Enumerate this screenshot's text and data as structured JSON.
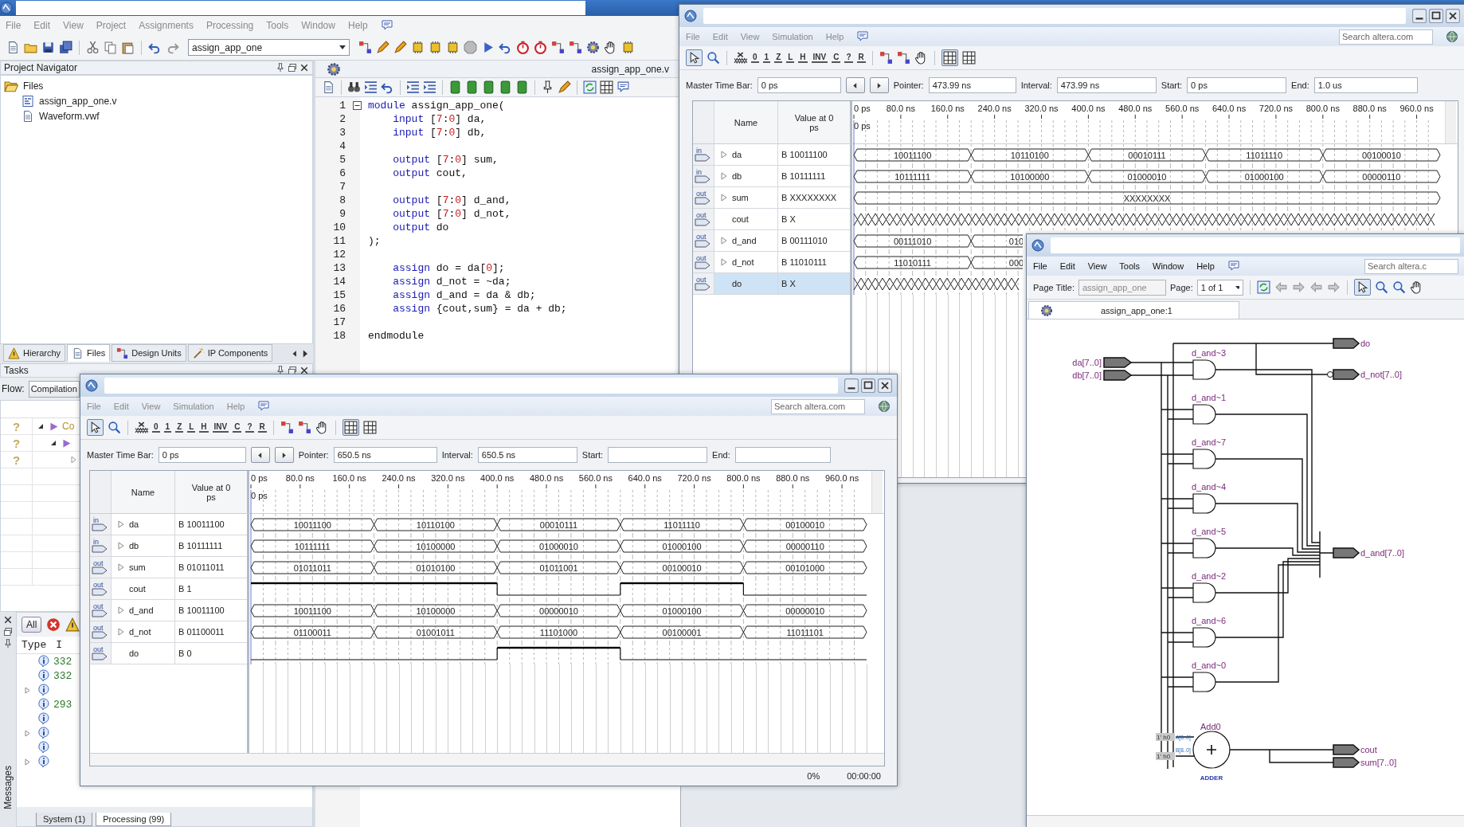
{
  "ide": {
    "menu": [
      "File",
      "Edit",
      "View",
      "Project",
      "Assignments",
      "Processing",
      "Tools",
      "Window",
      "Help"
    ],
    "project_select": "assign_app_one",
    "project_navigator": {
      "title": "Project Navigator",
      "tree": [
        {
          "label": "Files",
          "expanded": true,
          "children": [
            {
              "label": "assign_app_one.v",
              "kind": "source"
            },
            {
              "label": "Waveform.vwf",
              "kind": "document"
            }
          ]
        }
      ],
      "tabs": [
        {
          "label": "Hierarchy",
          "selected": false
        },
        {
          "label": "Files",
          "selected": true
        },
        {
          "label": "Design Units",
          "selected": false
        },
        {
          "label": "IP Components",
          "selected": false
        }
      ]
    },
    "editor": {
      "title": "assign_app_one.v",
      "lines": [
        {
          "number": "1",
          "fold_start": true,
          "tokens": [
            {
              "text": "module",
              "kind": "keyword"
            },
            {
              "text": " assign_app_one(",
              "kind": "plain"
            }
          ]
        },
        {
          "number": "2",
          "fold_start": false,
          "tokens": [
            {
              "text": "    input",
              "kind": "keyword"
            },
            {
              "text": " [",
              "kind": "plain"
            },
            {
              "text": "7",
              "kind": "number"
            },
            {
              "text": ":",
              "kind": "plain"
            },
            {
              "text": "0",
              "kind": "number"
            },
            {
              "text": "] da,",
              "kind": "plain"
            }
          ]
        },
        {
          "number": "3",
          "fold_start": false,
          "tokens": [
            {
              "text": "    input",
              "kind": "keyword"
            },
            {
              "text": " [",
              "kind": "plain"
            },
            {
              "text": "7",
              "kind": "number"
            },
            {
              "text": ":",
              "kind": "plain"
            },
            {
              "text": "0",
              "kind": "number"
            },
            {
              "text": "] db,",
              "kind": "plain"
            }
          ]
        },
        {
          "number": "4",
          "fold_start": false
        },
        {
          "number": "5",
          "fold_start": false,
          "tokens": [
            {
              "text": "    output",
              "kind": "keyword"
            },
            {
              "text": " [",
              "kind": "plain"
            },
            {
              "text": "7",
              "kind": "number"
            },
            {
              "text": ":",
              "kind": "plain"
            },
            {
              "text": "0",
              "kind": "number"
            },
            {
              "text": "] sum,",
              "kind": "plain"
            }
          ]
        },
        {
          "number": "6",
          "fold_start": false,
          "tokens": [
            {
              "text": "    output",
              "kind": "keyword"
            },
            {
              "text": " cout,",
              "kind": "plain"
            }
          ]
        },
        {
          "number": "7",
          "fold_start": false
        },
        {
          "number": "8",
          "fold_start": false,
          "tokens": [
            {
              "text": "    output",
              "kind": "keyword"
            },
            {
              "text": " [",
              "kind": "plain"
            },
            {
              "text": "7",
              "kind": "number"
            },
            {
              "text": ":",
              "kind": "plain"
            },
            {
              "text": "0",
              "kind": "number"
            },
            {
              "text": "] d_and,",
              "kind": "plain"
            }
          ]
        },
        {
          "number": "9",
          "fold_start": false,
          "tokens": [
            {
              "text": "    output",
              "kind": "keyword"
            },
            {
              "text": " [",
              "kind": "plain"
            },
            {
              "text": "7",
              "kind": "number"
            },
            {
              "text": ":",
              "kind": "plain"
            },
            {
              "text": "0",
              "kind": "number"
            },
            {
              "text": "] d_not,",
              "kind": "plain"
            }
          ]
        },
        {
          "number": "10",
          "fold_start": false,
          "tokens": [
            {
              "text": "    output",
              "kind": "keyword"
            },
            {
              "text": " do",
              "kind": "plain"
            }
          ]
        },
        {
          "number": "11",
          "fold_start": false,
          "tokens": [
            {
              "text": ");",
              "kind": "plain"
            }
          ]
        },
        {
          "number": "12",
          "fold_start": false
        },
        {
          "number": "13",
          "fold_start": false,
          "tokens": [
            {
              "text": "    assign",
              "kind": "keyword"
            },
            {
              "text": " do = da[",
              "kind": "plain"
            },
            {
              "text": "0",
              "kind": "number"
            },
            {
              "text": "];",
              "kind": "plain"
            }
          ]
        },
        {
          "number": "14",
          "fold_start": false,
          "tokens": [
            {
              "text": "    assign",
              "kind": "keyword"
            },
            {
              "text": " d_not = ~da;",
              "kind": "plain"
            }
          ]
        },
        {
          "number": "15",
          "fold_start": false,
          "tokens": [
            {
              "text": "    assign",
              "kind": "keyword"
            },
            {
              "text": " d_and = da & db;",
              "kind": "plain"
            }
          ]
        },
        {
          "number": "16",
          "fold_start": false,
          "tokens": [
            {
              "text": "    assign",
              "kind": "keyword"
            },
            {
              "text": " {cout,sum} = da + db;",
              "kind": "plain"
            }
          ]
        },
        {
          "number": "17",
          "fold_start": false
        },
        {
          "number": "18",
          "fold_start": false,
          "tokens": [
            {
              "text": "endmodule",
              "kind": "plain"
            }
          ]
        }
      ]
    },
    "tasks": {
      "title": "Tasks",
      "flow_label": "Flow:",
      "flow": "Compilation",
      "rows": [
        {
          "kind": "group",
          "status": "?",
          "expanded": true,
          "label": "Co"
        },
        {
          "kind": "group",
          "status": "?",
          "expanded": true
        },
        {
          "kind": "note",
          "status": "?",
          "expanded": false
        }
      ]
    },
    "messages": {
      "title": "Messages",
      "filter": "All",
      "columns": [
        "Type",
        "I"
      ],
      "rows": [
        {
          "expandable": false,
          "id": "332"
        },
        {
          "expandable": false,
          "id": "332"
        },
        {
          "expandable": true
        },
        {
          "expandable": false,
          "id": "293"
        },
        {
          "expandable": false
        },
        {
          "expandable": true
        },
        {
          "expandable": false
        },
        {
          "expandable": true
        }
      ],
      "tabs": [
        {
          "label": "System (1)",
          "selected": false
        },
        {
          "label": "Processing (99)",
          "selected": true
        }
      ]
    }
  },
  "simulation_top": {
    "menu": [
      "File",
      "Edit",
      "View",
      "Simulation",
      "Help"
    ],
    "search": {
      "placeholder": "Search altera.com"
    },
    "tool_glyphs": [
      "0",
      "1",
      "Z",
      "L",
      "H",
      "INV",
      "C",
      "?",
      "R"
    ],
    "time_bar": {
      "master_label": "Master Time Bar:",
      "master": "0 ps",
      "pointer_label": "Pointer:",
      "pointer": "473.99 ns",
      "interval_label": "Interval:",
      "interval": "473.99 ns",
      "start_label": "Start:",
      "start": "0 ps",
      "end_label": "End:",
      "end": "1.0 us"
    },
    "columns": [
      "Name",
      "Value at 0 ps"
    ],
    "ticks": [
      "0 ps",
      "80.0 ns",
      "160.0 ns",
      "240.0 ns",
      "320.0 ns",
      "400.0 ns",
      "480.0 ns",
      "560.0 ns",
      "640.0 ns",
      "720.0 ns",
      "800.0 ns",
      "880.0 ns",
      "960.0 ns"
    ],
    "cursor_label": "0 ps",
    "signals": [
      {
        "direction": "in",
        "name": "da",
        "expandable": true,
        "value": "B 10011100",
        "kind": "bus",
        "selected": false,
        "segments": [
          "10011100",
          "10110100",
          "00010111",
          "11011110",
          "00100010"
        ]
      },
      {
        "direction": "in",
        "name": "db",
        "expandable": true,
        "value": "B 10111111",
        "kind": "bus",
        "selected": false,
        "segments": [
          "10111111",
          "10100000",
          "01000010",
          "01000100",
          "00000110"
        ]
      },
      {
        "direction": "out",
        "name": "sum",
        "expandable": true,
        "value": "B XXXXXXXX",
        "kind": "bus",
        "selected": false,
        "segments": [
          "XXXXXXXX"
        ]
      },
      {
        "direction": "out",
        "name": "cout",
        "expandable": false,
        "value": "B X",
        "kind": "unknown",
        "selected": false
      },
      {
        "direction": "out",
        "name": "d_and",
        "expandable": true,
        "value": "B 00111010",
        "kind": "bus",
        "selected": false,
        "segments": [
          "00111010",
          "010"
        ]
      },
      {
        "direction": "out",
        "name": "d_not",
        "expandable": true,
        "value": "B 11010111",
        "kind": "bus",
        "selected": false,
        "segments": [
          "11010111",
          "000"
        ]
      },
      {
        "direction": "out",
        "name": "do",
        "expandable": false,
        "value": "B X",
        "kind": "unknown",
        "selected": true
      }
    ]
  },
  "schematic": {
    "menu": [
      "File",
      "Edit",
      "View",
      "Tools",
      "Window",
      "Help"
    ],
    "search": {
      "placeholder": "Search altera.c"
    },
    "page_title_label": "Page Title:",
    "page_title": "assign_app_one",
    "page_label": "Page:",
    "page": "1 of 1",
    "tab": "assign_app_one:1",
    "inputs": [
      "da[7..0]",
      "db[7..0]"
    ],
    "gates": [
      "d_and~3",
      "d_and~1",
      "d_and~7",
      "d_and~4",
      "d_and~5",
      "d_and~2",
      "d_and~6",
      "d_and~0"
    ],
    "outputs": [
      {
        "label": "do",
        "inverted": false
      },
      {
        "label": "d_not[7..0]",
        "inverted": true
      },
      {
        "label": "d_and[7..0]",
        "inverted": false
      },
      {
        "label": "cout",
        "inverted": false
      },
      {
        "label": "sum[7..0]",
        "inverted": false
      }
    ],
    "adder": {
      "name": "Add0",
      "type": "ADDER",
      "ports": [
        "A[8..0]",
        "B[8..0]"
      ],
      "constants": [
        "1' h0",
        "1' h0"
      ]
    }
  },
  "simulation_bottom": {
    "menu": [
      "File",
      "Edit",
      "View",
      "Simulation",
      "Help"
    ],
    "search": {
      "placeholder": "Search altera.com"
    },
    "tool_glyphs": [
      "0",
      "1",
      "Z",
      "L",
      "H",
      "INV",
      "C",
      "?",
      "R"
    ],
    "time_bar": {
      "master_label": "Master Time Bar:",
      "master": "0 ps",
      "pointer_label": "Pointer:",
      "pointer": "650.5 ns",
      "interval_label": "Interval:",
      "interval": "650.5 ns",
      "start_label": "Start:",
      "end_label": "End:"
    },
    "columns": [
      "Name",
      "Value at 0 ps"
    ],
    "ticks": [
      "0 ps",
      "80.0 ns",
      "160.0 ns",
      "240.0 ns",
      "320.0 ns",
      "400.0 ns",
      "480.0 ns",
      "560.0 ns",
      "640.0 ns",
      "720.0 ns",
      "800.0 ns",
      "880.0 ns",
      "960.0 ns"
    ],
    "cursor_label": "0 ps",
    "signals": [
      {
        "direction": "in",
        "name": "da",
        "expandable": true,
        "value": "B 10011100",
        "kind": "bus",
        "selected": false,
        "segments": [
          "10011100",
          "10110100",
          "00010111",
          "11011110",
          "00100010"
        ]
      },
      {
        "direction": "in",
        "name": "db",
        "expandable": true,
        "value": "B 10111111",
        "kind": "bus",
        "selected": false,
        "segments": [
          "10111111",
          "10100000",
          "01000010",
          "01000100",
          "00000110"
        ]
      },
      {
        "direction": "out",
        "name": "sum",
        "expandable": true,
        "value": "B 01011011",
        "kind": "bus",
        "selected": false,
        "segments": [
          "01011011",
          "01010100",
          "01011001",
          "00100010",
          "00101000"
        ]
      },
      {
        "direction": "out",
        "name": "cout",
        "expandable": false,
        "value": "B 1",
        "kind": "bit",
        "selected": false,
        "high": [
          true,
          true,
          false,
          true,
          false
        ]
      },
      {
        "direction": "out",
        "name": "d_and",
        "expandable": true,
        "value": "B 10011100",
        "kind": "bus",
        "selected": false,
        "segments": [
          "10011100",
          "10100000",
          "00000010",
          "01000100",
          "00000010"
        ]
      },
      {
        "direction": "out",
        "name": "d_not",
        "expandable": true,
        "value": "B 01100011",
        "kind": "bus",
        "selected": false,
        "segments": [
          "01100011",
          "01001011",
          "11101000",
          "00100001",
          "11011101"
        ]
      },
      {
        "direction": "out",
        "name": "do",
        "expandable": false,
        "value": "B 0",
        "kind": "bit",
        "selected": false,
        "high": [
          false,
          false,
          true,
          false,
          false
        ]
      }
    ],
    "status": {
      "progress": "0%",
      "elapsed": "00:00:00"
    }
  }
}
